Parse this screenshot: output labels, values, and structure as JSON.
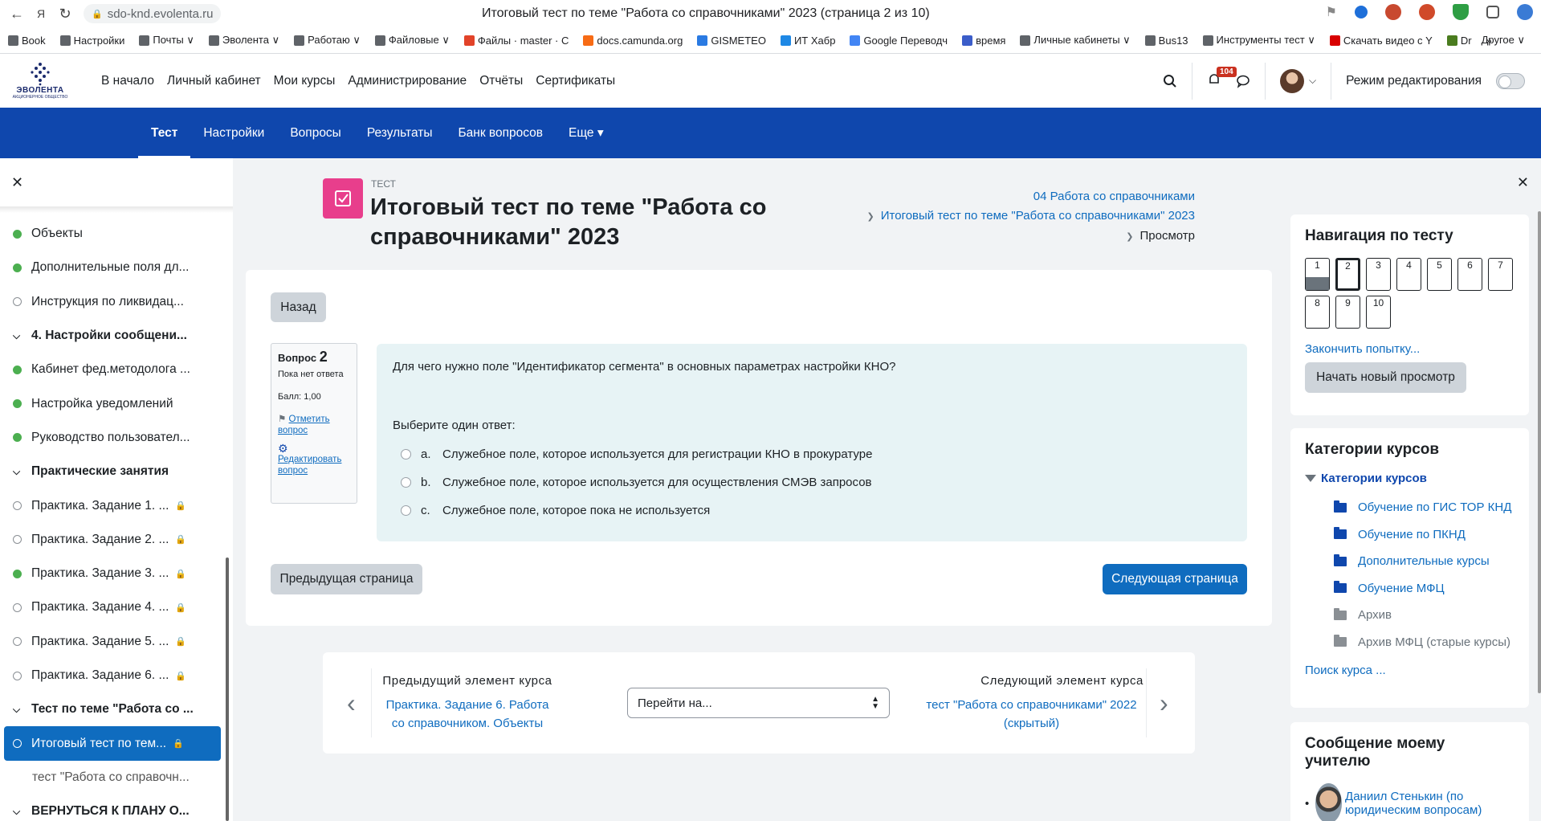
{
  "browser": {
    "url": "sdo-knd.evolenta.ru",
    "tab_title": "Итоговый тест по теме \"Работа со справочниками\" 2023 (страница 2 из 10)",
    "bookmarks": [
      "Book",
      "Настройки",
      "Почты ∨",
      "Эволента ∨",
      "Работаю ∨",
      "Файловые ∨",
      "Файлы · master · C",
      "docs.camunda.org",
      "GISMETEO",
      "ИТ Хабр",
      "Google Переводч",
      "время",
      "Личные кабинеты ∨",
      "Bus13",
      "Инструменты тест ∨",
      "Скачать видео с Y",
      "Dr",
      "»"
    ],
    "bookmarks_other": "Другое ∨",
    "bookmark_colors": [
      "#5f6368",
      "#5f6368",
      "#5f6368",
      "#5f6368",
      "#5f6368",
      "#5f6368",
      "#e24329",
      "#f76b15",
      "#2a7ae2",
      "#1e88e5",
      "#4285f4",
      "#3b5dc9",
      "#5f6368",
      "#5f6368",
      "#5f6368",
      "#d80000",
      "#4a7c1f",
      "#5f6368"
    ]
  },
  "header": {
    "logo_text": "ЭВОЛЕНТА",
    "logo_sub": "АКЦИОНЕРНОЕ ОБЩЕСТВО",
    "nav": [
      "В начало",
      "Личный кабинет",
      "Мои курсы",
      "Администрирование",
      "Отчёты",
      "Сертификаты"
    ],
    "notifications_count": "104",
    "edit_mode_label": "Режим редактирования"
  },
  "secondary_nav": {
    "items": [
      "Тест",
      "Настройки",
      "Вопросы",
      "Результаты",
      "Банк вопросов",
      "Еще ▾"
    ],
    "active_index": 0
  },
  "course_index": {
    "items": [
      {
        "label": "Объекты",
        "type": "done"
      },
      {
        "label": "Дополнительные поля дл...",
        "type": "done"
      },
      {
        "label": "Инструкция по ликвидац...",
        "type": "open"
      },
      {
        "label": "4. Настройки сообщени...",
        "type": "section"
      },
      {
        "label": "Кабинет фед.методолога ...",
        "type": "done"
      },
      {
        "label": "Настройка уведомлений",
        "type": "done"
      },
      {
        "label": "Руководство пользовател...",
        "type": "done"
      },
      {
        "label": "Практические занятия",
        "type": "section"
      },
      {
        "label": "Практика. Задание 1. ...",
        "type": "open",
        "locked": true
      },
      {
        "label": "Практика. Задание 2. ...",
        "type": "open",
        "locked": true
      },
      {
        "label": "Практика. Задание 3. ...",
        "type": "done",
        "locked": true
      },
      {
        "label": "Практика. Задание 4. ...",
        "type": "open",
        "locked": true
      },
      {
        "label": "Практика. Задание 5. ...",
        "type": "open",
        "locked": true
      },
      {
        "label": "Практика. Задание 6. ...",
        "type": "open",
        "locked": true
      },
      {
        "label": "Тест по теме \"Работа со ...",
        "type": "section"
      },
      {
        "label": "Итоговый тест по тем...",
        "type": "open",
        "locked": true,
        "active": true
      },
      {
        "label": "тест \"Работа со справочн...",
        "type": "plain"
      },
      {
        "label": "ВЕРНУТЬСЯ К ПЛАНУ О...",
        "type": "section"
      }
    ]
  },
  "page": {
    "activity_type": "ТЕСТ",
    "title": "Итоговый тест по теме \"Работа со справочниками\" 2023",
    "breadcrumbs": [
      "04 Работа со справочниками",
      "Итоговый тест по теме \"Работа со справочниками\" 2023",
      "Просмотр"
    ]
  },
  "question": {
    "back_label": "Назад",
    "number_prefix": "Вопрос",
    "number": "2",
    "status": "Пока нет ответа",
    "mark": "Балл: 1,00",
    "flag_label": "Отметить вопрос",
    "edit_label": "Редактировать вопрос",
    "text": "Для чего нужно поле \"Идентификатор сегмента\" в основных параметрах настройки КНО?",
    "prompt": "Выберите один ответ:",
    "options": [
      {
        "letter": "a.",
        "text": "Служебное поле, которое используется для регистрации КНО в прокуратуре"
      },
      {
        "letter": "b.",
        "text": "Служебное поле, которое используется для осуществления СМЭВ запросов"
      },
      {
        "letter": "c.",
        "text": "Служебное поле, которое пока не используется"
      }
    ],
    "prev_page": "Предыдущая страница",
    "next_page": "Следующая страница"
  },
  "activity_nav": {
    "prev_head": "Предыдущий элемент курса",
    "prev_link": "Практика. Задание 6. Работа со справочником. Объекты",
    "jump_placeholder": "Перейти на...",
    "next_head": "Следующий элемент курса",
    "next_link": "тест \"Работа со справочниками\" 2022 (скрытый)"
  },
  "quiz_nav": {
    "title": "Навигация по тесту",
    "buttons": [
      "1",
      "2",
      "3",
      "4",
      "5",
      "6",
      "7",
      "8",
      "9",
      "10"
    ],
    "answered": [
      0
    ],
    "current": 1,
    "finish_label": "Закончить попытку...",
    "restart_label": "Начать новый просмотр"
  },
  "categories": {
    "title": "Категории курсов",
    "root": "Категории курсов",
    "items": [
      {
        "label": "Обучение по ГИС ТОР КНД",
        "dim": false
      },
      {
        "label": "Обучение по ПКНД",
        "dim": false
      },
      {
        "label": "Дополнительные курсы",
        "dim": false
      },
      {
        "label": "Обучение МФЦ",
        "dim": false
      },
      {
        "label": "Архив",
        "dim": true
      },
      {
        "label": "Архив МФЦ (старые курсы)",
        "dim": true
      }
    ],
    "search_label": "Поиск курса ..."
  },
  "message_teacher": {
    "title": "Сообщение моему учителю",
    "teacher": "Даниил Стенькин (по юридическим вопросам)"
  }
}
